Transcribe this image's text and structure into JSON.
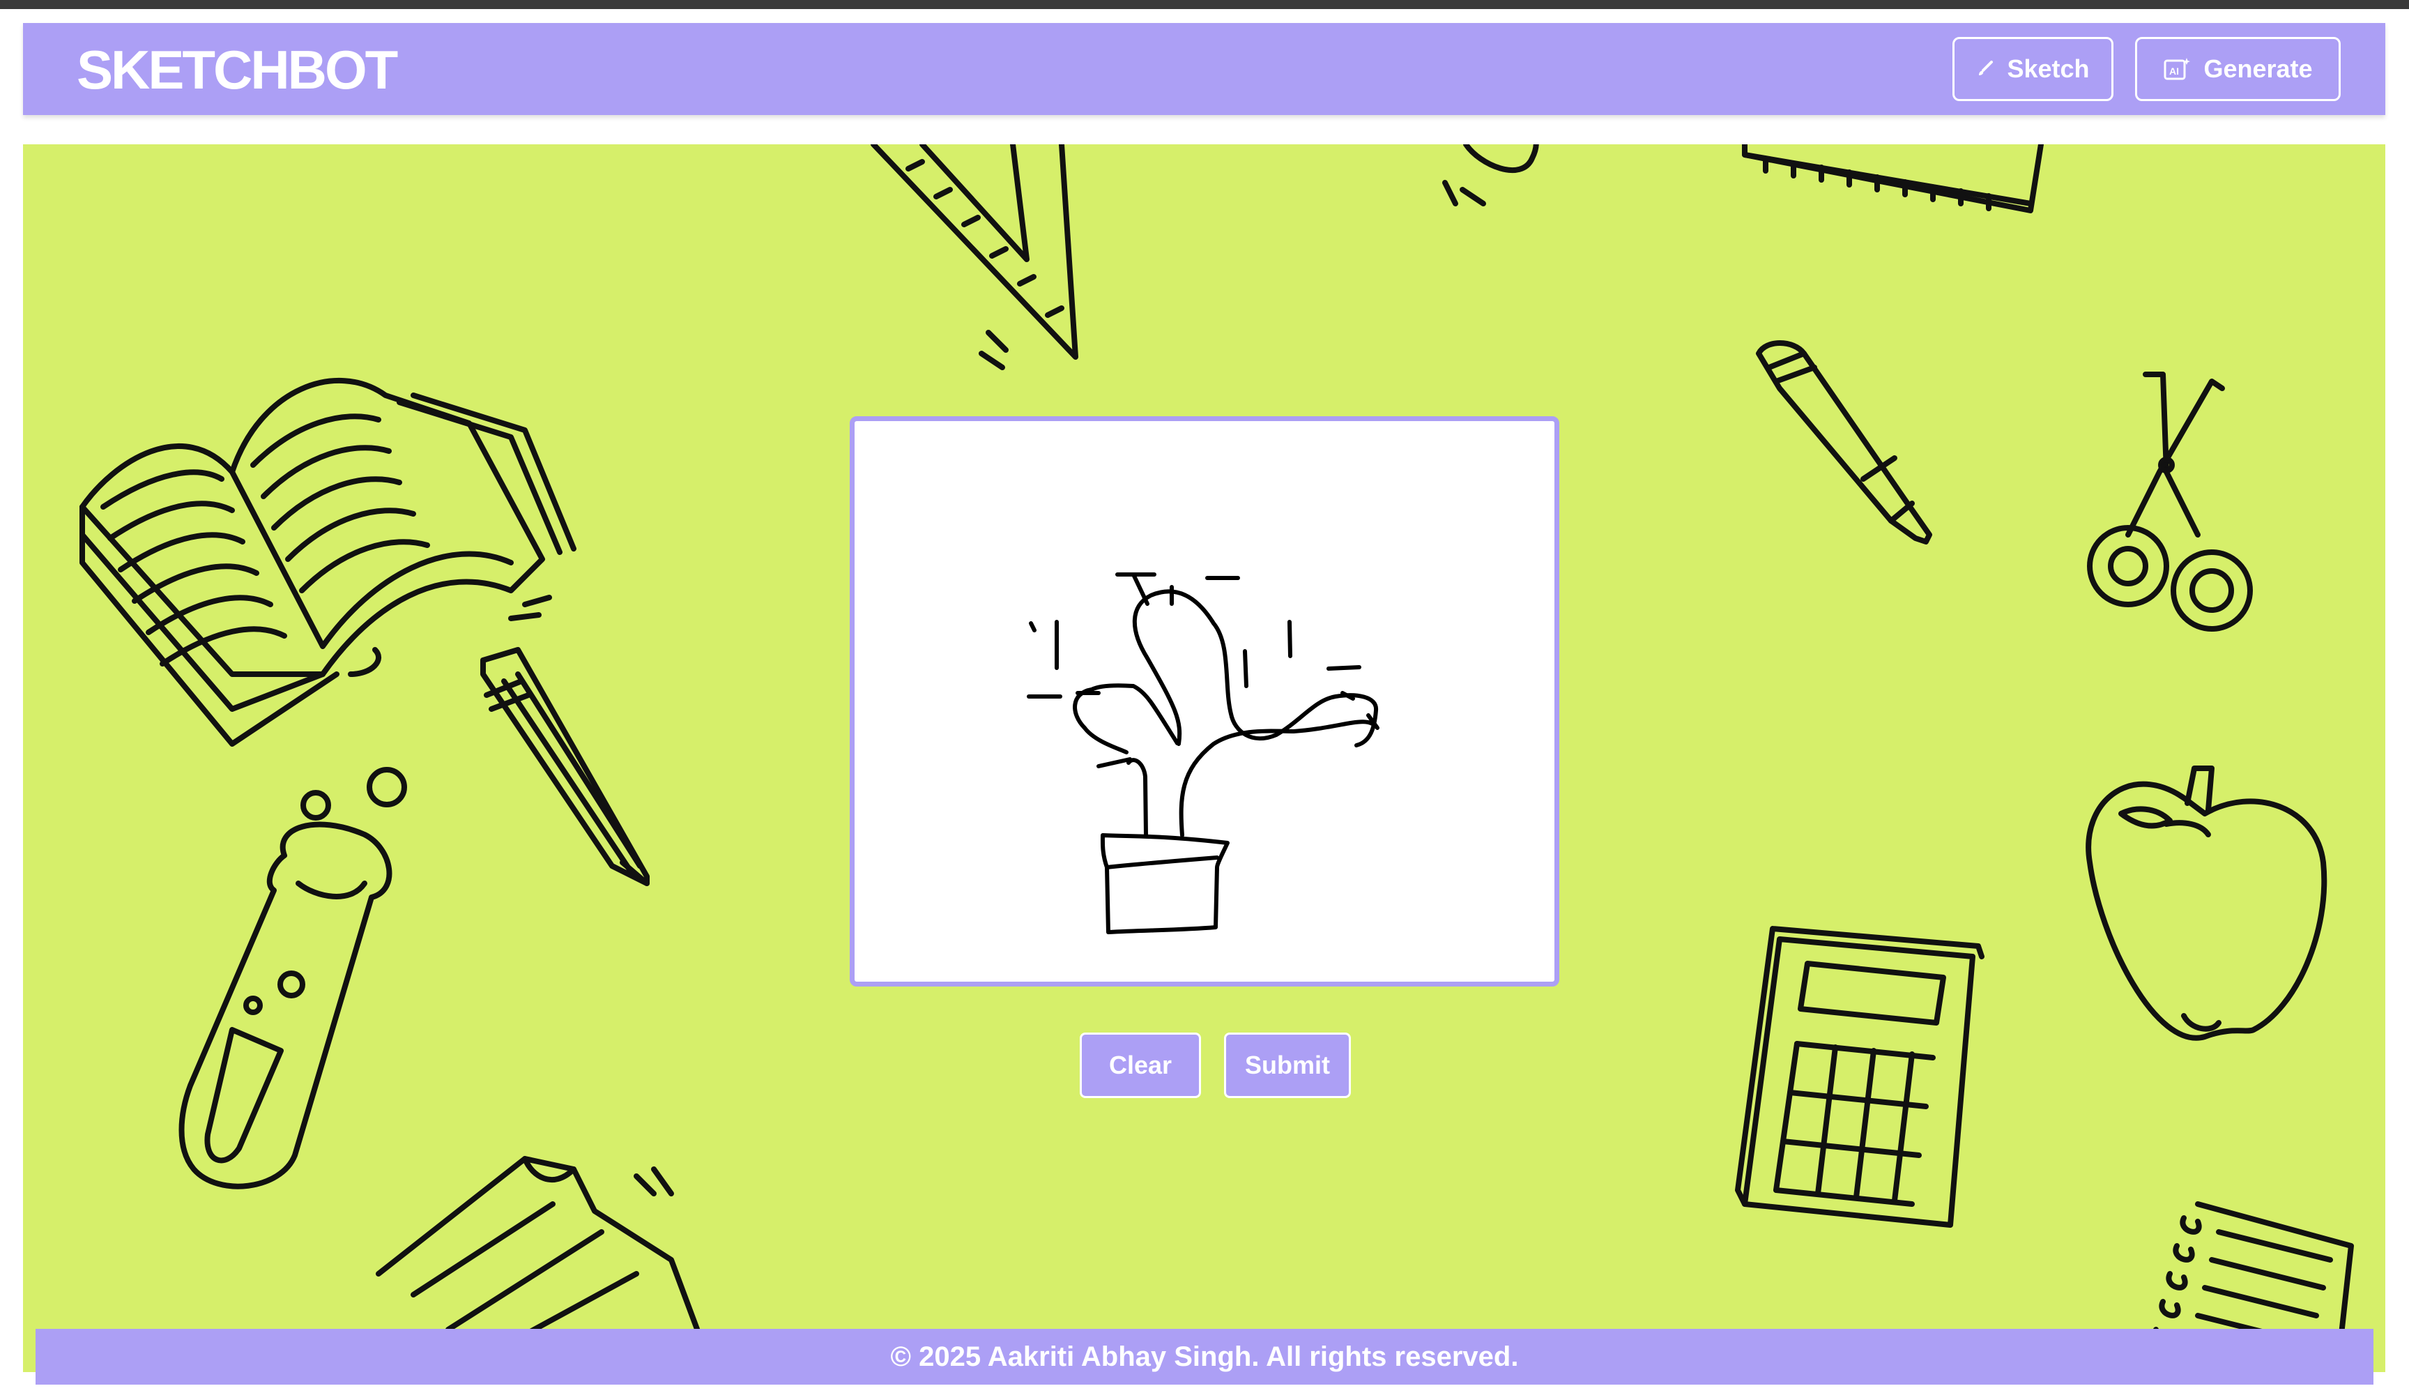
{
  "header": {
    "brand": "SKETCHBOT",
    "nav": [
      {
        "label": "Sketch",
        "icon": "brush-icon"
      },
      {
        "label": "Generate",
        "icon": "ai-icon"
      }
    ]
  },
  "canvas": {
    "drawing": "cactus-in-pot-sketch"
  },
  "actions": {
    "clear_label": "Clear",
    "submit_label": "Submit"
  },
  "footer": {
    "text": "© 2025 Aakriti Abhay Singh. All rights reserved."
  },
  "colors": {
    "accent": "#ac9ff5",
    "background": "#d6ef6a",
    "ink": "#111111",
    "white": "#ffffff"
  }
}
